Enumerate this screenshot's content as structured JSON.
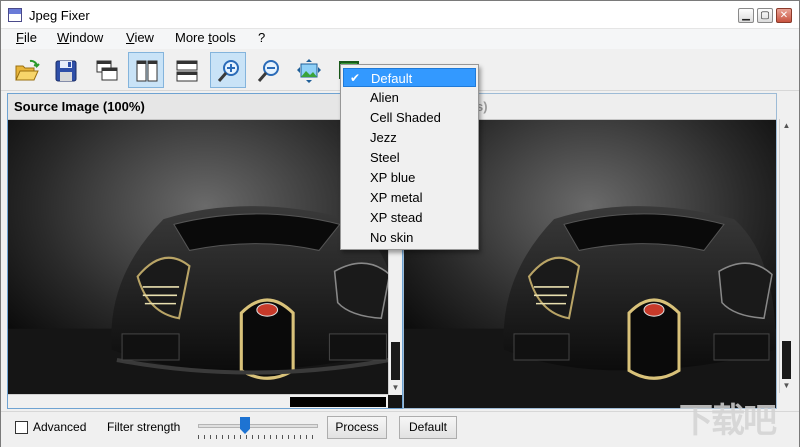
{
  "window": {
    "title": "Jpeg Fixer"
  },
  "menu": {
    "file": {
      "mnemonic": "F",
      "rest": "ile"
    },
    "window": {
      "mnemonic": "W",
      "rest": "indow"
    },
    "view": {
      "mnemonic": "V",
      "rest": "iew"
    },
    "more_tools": {
      "head": "More ",
      "mnemonic": "t",
      "rest": "ools"
    },
    "help": "?"
  },
  "toolbar": {
    "buttons": [
      {
        "name": "open-folder-icon"
      },
      {
        "name": "save-disk-icon"
      },
      {
        "name": "cascade-windows-icon"
      },
      {
        "name": "tile-vertical-icon",
        "active": true
      },
      {
        "name": "tile-horizontal-icon"
      },
      {
        "name": "zoom-in-icon",
        "active": true
      },
      {
        "name": "zoom-out-icon"
      },
      {
        "name": "fit-image-icon"
      },
      {
        "name": "skin-icon"
      }
    ]
  },
  "skin_menu": {
    "items": [
      "Default",
      "Alien",
      "Cell Shaded",
      "Jezz",
      "Steel",
      "XP blue",
      "XP metal",
      "XP stead",
      "No skin"
    ],
    "selected": "Default",
    "check": "✔"
  },
  "panes": {
    "source_title": "Source Image (100%)",
    "result_title_partial": "s)"
  },
  "bottom": {
    "advanced_label": "Advanced",
    "filter_label": "Filter strength",
    "process_label": "Process",
    "default_label": "Default"
  },
  "watermark": "下载吧",
  "colors": {
    "accent": "#3399ff",
    "pane_border_active": "#6fa3d2"
  }
}
